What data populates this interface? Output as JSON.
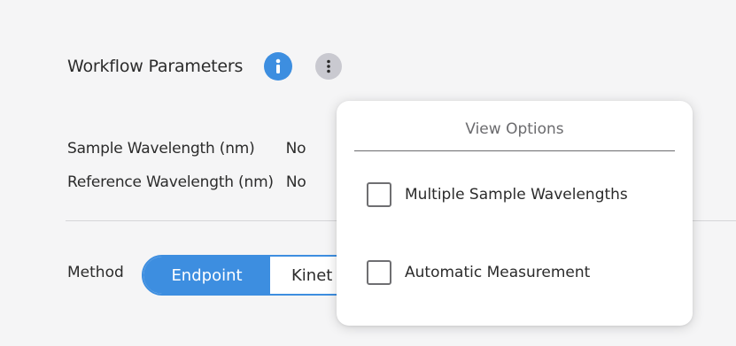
{
  "header": {
    "title": "Workflow Parameters",
    "info_icon": "info-icon",
    "more_icon": "more-vertical-icon"
  },
  "params": [
    {
      "label": "Sample Wavelength (nm)",
      "value": "No"
    },
    {
      "label": "Reference Wavelength (nm)",
      "value": "No"
    }
  ],
  "method": {
    "label": "Method",
    "options": [
      {
        "label": "Endpoint",
        "active": true
      },
      {
        "label": "Kinet",
        "active": false
      }
    ]
  },
  "popover": {
    "title": "View Options",
    "options": [
      {
        "label": "Multiple Sample Wavelengths",
        "checked": false
      },
      {
        "label": "Automatic Measurement",
        "checked": false
      }
    ]
  },
  "colors": {
    "accent": "#3d8ee0",
    "more_button_bg": "#c9c9d0",
    "background": "#f5f5f6"
  }
}
